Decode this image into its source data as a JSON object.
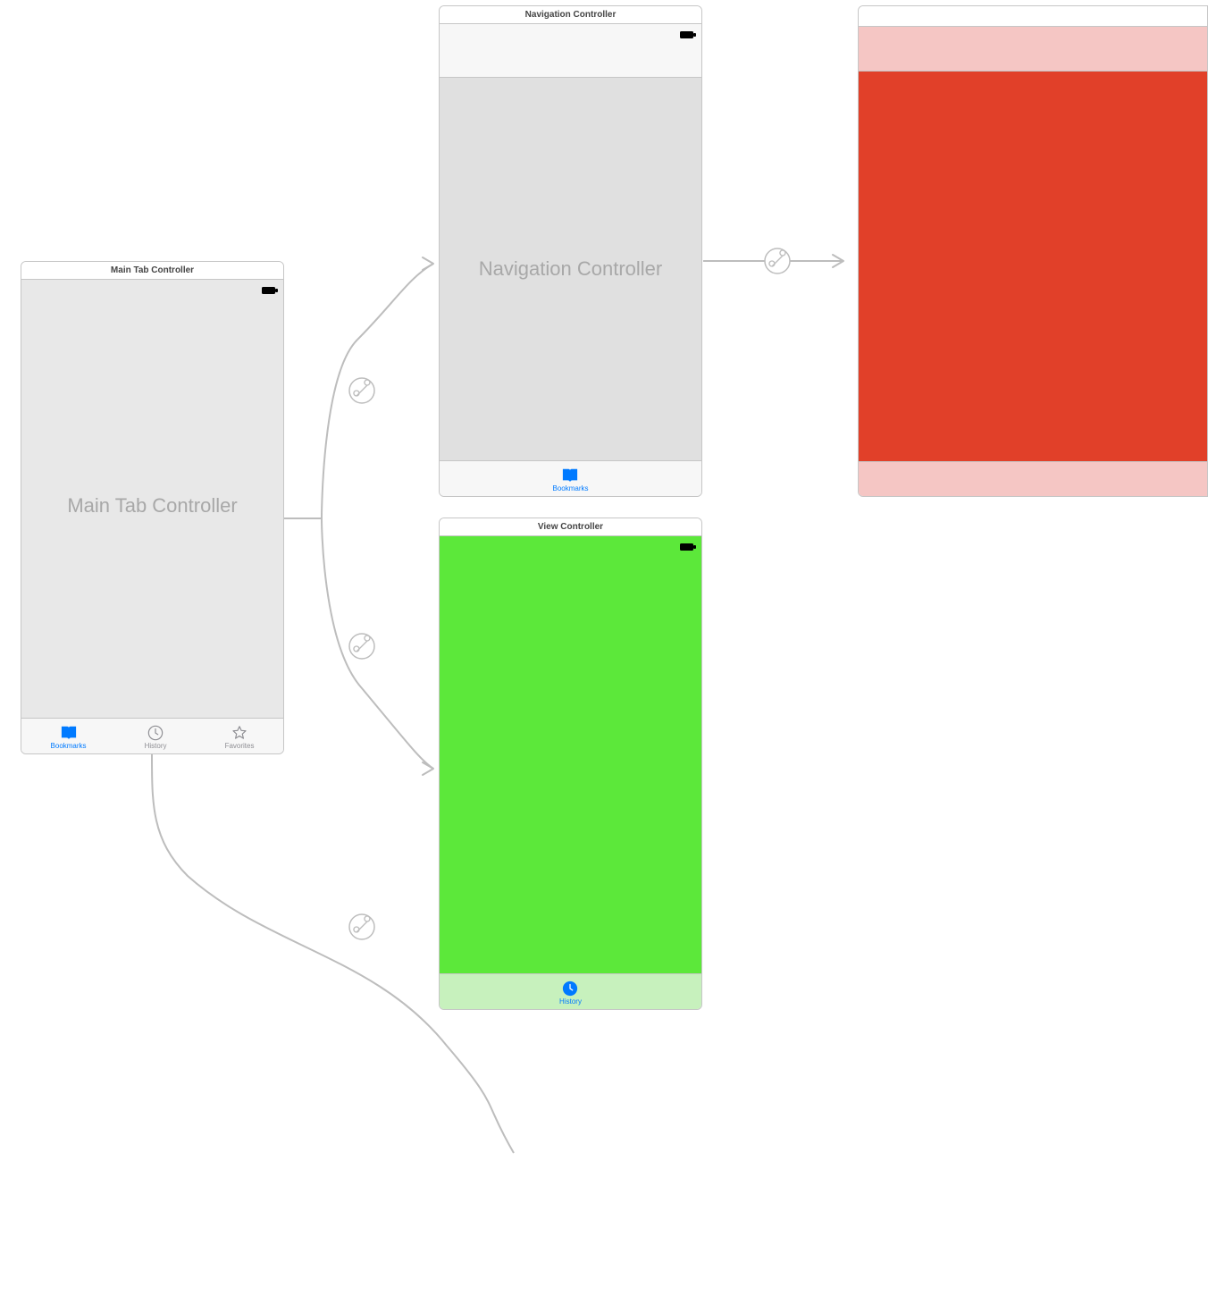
{
  "colors": {
    "tint_blue": "#007aff",
    "inactive_gray": "#8e8e93",
    "placeholder_gray": "#a8a8a8",
    "border": "#c6c6c6",
    "green_body": "#5ce83a",
    "green_tabbar": "#c7f1bd",
    "red_body": "#e14029",
    "red_navbar": "#f5c6c4",
    "scene_bg_light": "#e8e8e8",
    "scene_bg_dark": "#e0e0e0",
    "navstrip_bg": "#f7f7f7"
  },
  "scenes": {
    "main_tab": {
      "title": "Main Tab Controller",
      "placeholder": "Main Tab Controller",
      "tabs": [
        {
          "label": "Bookmarks",
          "icon": "bookmark-icon",
          "active": true
        },
        {
          "label": "History",
          "icon": "clock-icon",
          "active": false
        },
        {
          "label": "Favorites",
          "icon": "star-icon",
          "active": false
        }
      ]
    },
    "nav": {
      "title": "Navigation Controller",
      "placeholder": "Navigation Controller",
      "tabs": [
        {
          "label": "Bookmarks",
          "icon": "bookmark-icon",
          "active": true
        }
      ]
    },
    "view_green": {
      "title": "View Controller",
      "tabs": [
        {
          "label": "History",
          "icon": "clock-icon",
          "active": true
        }
      ]
    },
    "view_red": {
      "title": ""
    }
  }
}
